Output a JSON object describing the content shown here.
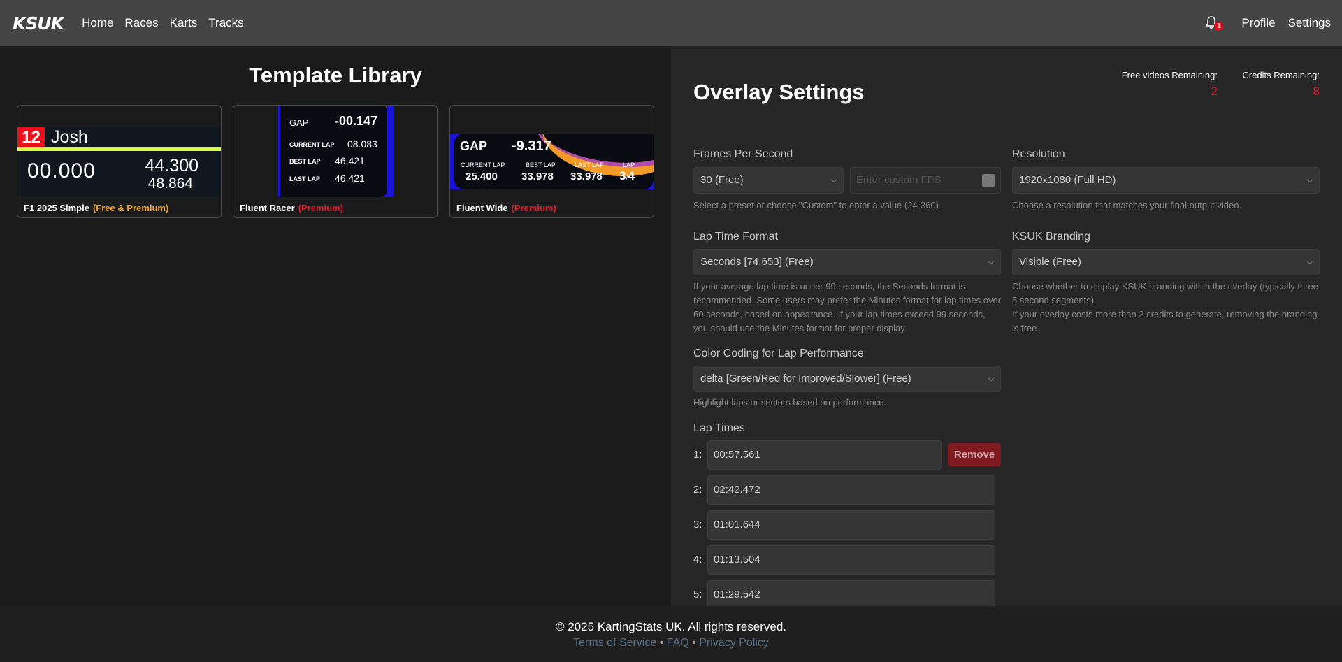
{
  "nav": {
    "brand": "KSUK",
    "links": [
      "Home",
      "Races",
      "Karts",
      "Tracks"
    ],
    "notification_count": "1",
    "profile": "Profile",
    "settings": "Settings"
  },
  "library": {
    "title": "Template Library",
    "templates": [
      {
        "name": "F1 2025 Simple",
        "tier": "(Free & Premium)",
        "preview": {
          "number": "12",
          "driver": "Josh",
          "main_time": "00.000",
          "time_a": "44.300",
          "time_b": "48.864"
        }
      },
      {
        "name": "Fluent Racer",
        "tier": "(Premium)",
        "preview": {
          "gap_label": "GAP",
          "gap_value": "-00.147",
          "current_label": "CURRENT LAP",
          "current_value": "08.083",
          "best_label": "BEST LAP",
          "best_value": "46.421",
          "last_label": "LAST LAP",
          "last_value": "46.421"
        }
      },
      {
        "name": "Fluent Wide",
        "tier": "(Premium)",
        "preview": {
          "gap_label": "GAP",
          "gap_value": "-9.317",
          "current_label": "CURRENT LAP",
          "current_value": "25.400",
          "best_label": "BEST LAP",
          "best_value": "33.978",
          "last_label": "LAST LAP",
          "last_value": "33.978",
          "lap_label": "LAP",
          "lap_current": "3",
          "lap_sep": "/",
          "lap_total": "4"
        }
      }
    ]
  },
  "settings": {
    "title": "Overlay Settings",
    "free_videos_label": "Free videos Remaining:",
    "free_videos_value": "2",
    "credits_label": "Credits Remaining:",
    "credits_value": "8",
    "fps": {
      "label": "Frames Per Second",
      "value": "30 (Free)",
      "custom_placeholder": "Enter custom FPS",
      "help": "Select a preset or choose \"Custom\" to enter a value (24-360)."
    },
    "resolution": {
      "label": "Resolution",
      "value": "1920x1080 (Full HD)",
      "help": "Choose a resolution that matches your final output video."
    },
    "lap_format": {
      "label": "Lap Time Format",
      "value": "Seconds [74.653] (Free)",
      "help": "If your average lap time is under 99 seconds, the Seconds format is recommended. Some users may prefer the Minutes format for lap times over 60 seconds, based on appearance. If your lap times exceed 99 seconds, you should use the Minutes format for proper display."
    },
    "branding": {
      "label": "KSUK Branding",
      "value": "Visible (Free)",
      "help1": "Choose whether to display KSUK branding within the overlay (typically three 5 second segments).",
      "help2": "If your overlay costs more than 2 credits to generate, removing the branding is free."
    },
    "color_coding": {
      "label": "Color Coding for Lap Performance",
      "value": "delta [Green/Red for Improved/Slower] (Free)",
      "help": "Highlight laps or sectors based on performance."
    },
    "lap_times": {
      "label": "Lap Times",
      "remove_label": "Remove",
      "laps": [
        {
          "num": "1:",
          "time": "00:57.561"
        },
        {
          "num": "2:",
          "time": "02:42.472"
        },
        {
          "num": "3:",
          "time": "01:01.644"
        },
        {
          "num": "4:",
          "time": "01:13.504"
        },
        {
          "num": "5:",
          "time": "01:29.542"
        }
      ]
    }
  },
  "footer": {
    "copyright": "© 2025 KartingStats UK. All rights reserved.",
    "terms": "Terms of Service",
    "sep1": " • ",
    "faq": "FAQ",
    "sep2": " • ",
    "privacy": "Privacy Policy"
  },
  "colors": {
    "accent_red": "#e8192c",
    "free_orange": "#f5a623",
    "nav_bg": "#444444"
  }
}
